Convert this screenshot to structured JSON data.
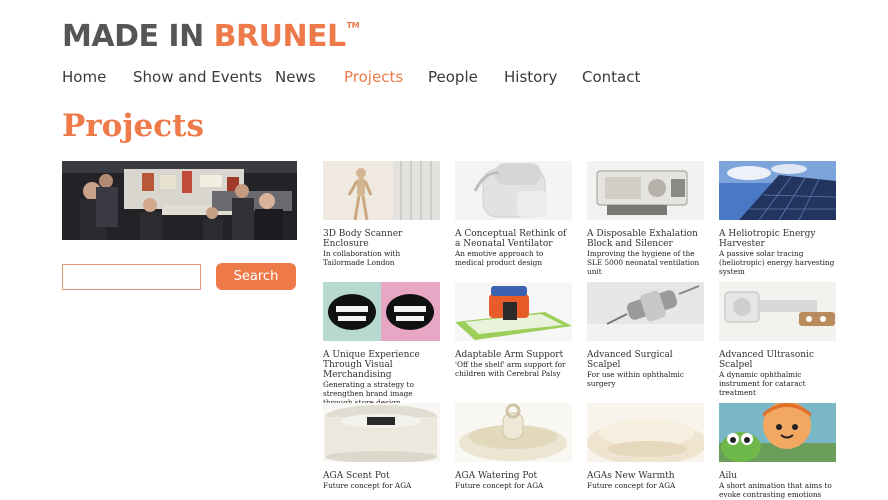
{
  "logo": {
    "part1": "MADE IN ",
    "part2": "BRUNEL",
    "tm": "TM"
  },
  "nav": [
    {
      "label": "Home"
    },
    {
      "label": "Show and Events"
    },
    {
      "label": "News"
    },
    {
      "label": "Projects",
      "active": true
    },
    {
      "label": "People"
    },
    {
      "label": "History"
    },
    {
      "label": "Contact"
    }
  ],
  "page_title": "Projects",
  "search": {
    "value": "",
    "placeholder": "",
    "button_label": "Search"
  },
  "colors": {
    "accent": "#ee7a4a",
    "text": "#3a3a3a",
    "logo_gray": "#555555"
  },
  "projects": [
    {
      "title": "3D Body Scanner Enclosure",
      "desc": "In collaboration with Tailormade London",
      "icon": "mannequin-image"
    },
    {
      "title": "A Conceptual Rethink of a Neonatal Ventilator",
      "desc": "An emotive approach to medical product design",
      "icon": "ventilator-image"
    },
    {
      "title": "A Disposable Exhalation Block and Silencer",
      "desc": "Improving the hygiene of the SLE 5000 neonatal ventilation unit",
      "icon": "exhalation-block-image"
    },
    {
      "title": "A Heliotropic Energy Harvester",
      "desc": "A passive solar tracing (heliotropic) energy harvesting system",
      "icon": "solar-panel-image"
    },
    {
      "title": "A Unique Experience Through Visual Merchandising",
      "desc": "Generating a strategy to strengthen brand image through store design",
      "icon": "mouths-artwork-image"
    },
    {
      "title": "Adaptable Arm Support",
      "desc": "'Off the shelf' arm support for children with Cerebral Palsy",
      "icon": "arm-support-image"
    },
    {
      "title": "Advanced Surgical Scalpel",
      "desc": "For use within ophthalmic surgery",
      "icon": "scalpel-image"
    },
    {
      "title": "Advanced Ultrasonic Scalpel",
      "desc": "A dynamic ophthalmic instrument for cataract treatment",
      "icon": "ultrasonic-scalpel-image"
    },
    {
      "title": "AGA Scent Pot",
      "desc": "Future concept for AGA",
      "icon": "scent-pot-image"
    },
    {
      "title": "AGA Watering Pot",
      "desc": "Future concept for AGA",
      "icon": "watering-pot-image"
    },
    {
      "title": "AGAs New Warmth",
      "desc": "Future concept for AGA",
      "icon": "warmth-image"
    },
    {
      "title": "Ailu",
      "desc": "A short animation that aims to evoke contrasting emotions",
      "icon": "animation-characters-image"
    }
  ]
}
